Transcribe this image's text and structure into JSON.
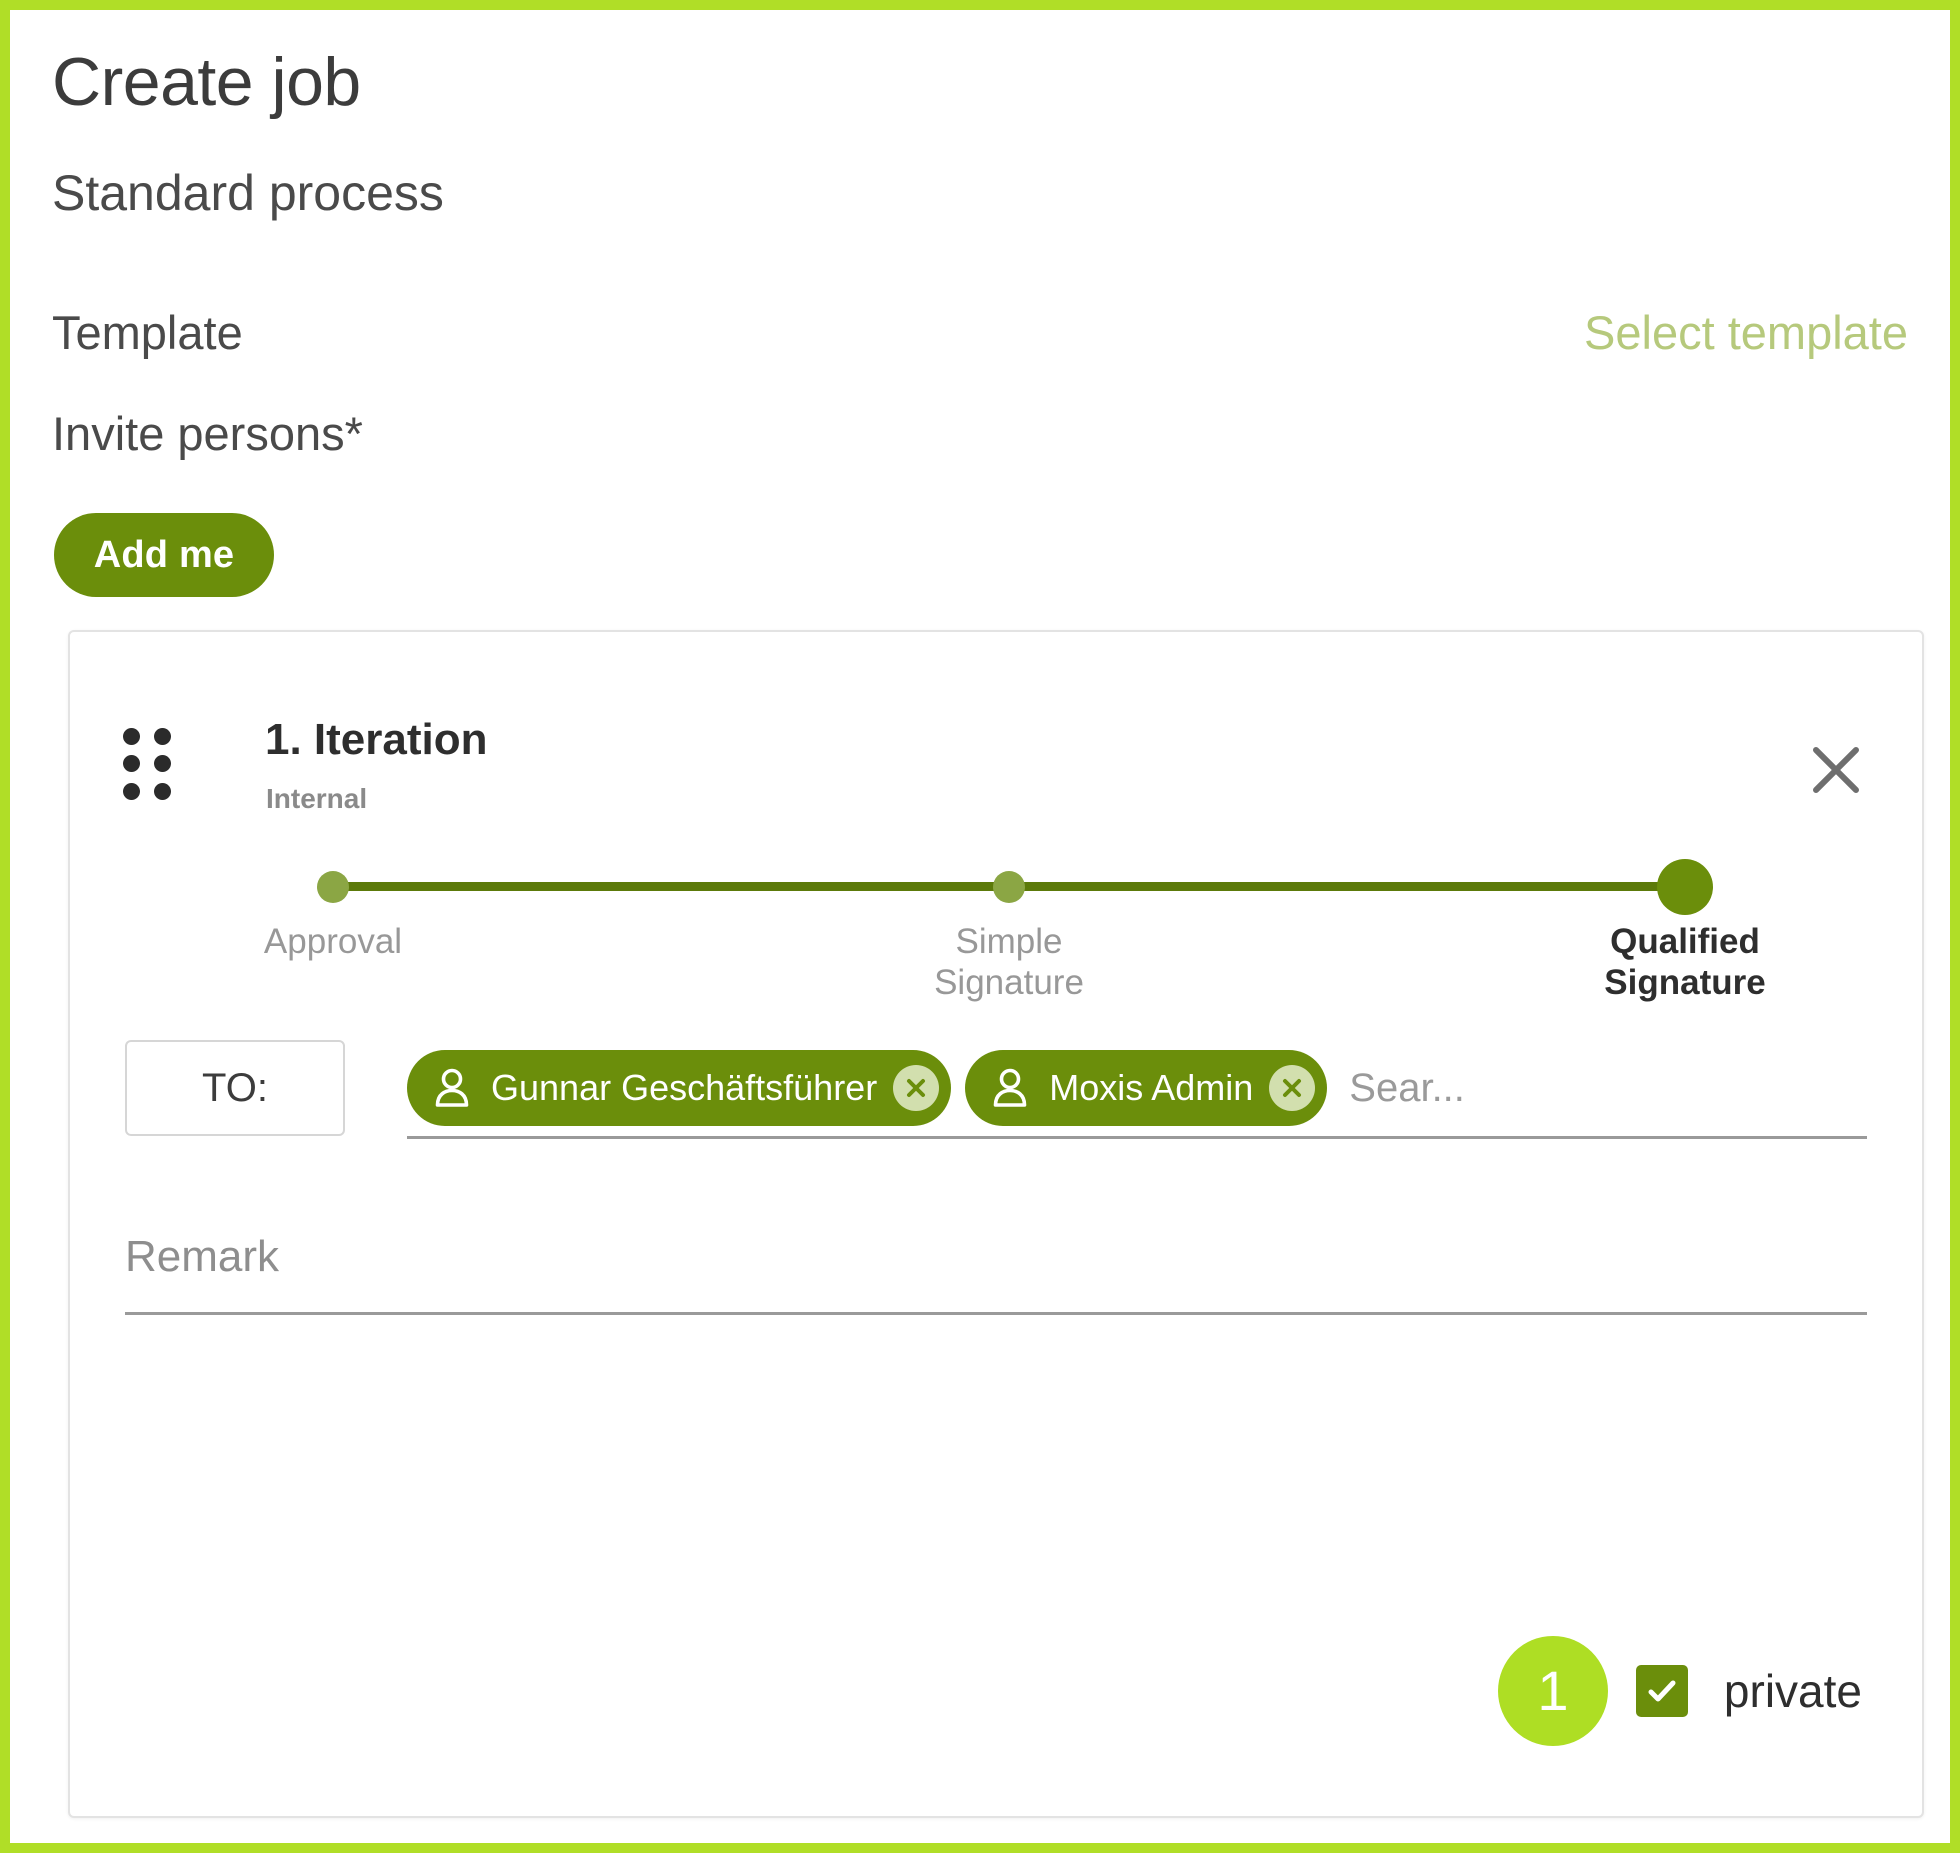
{
  "page": {
    "title": "Create job",
    "subtitle": "Standard process"
  },
  "template": {
    "label": "Template",
    "select_label": "Select template"
  },
  "invite": {
    "label": "Invite persons*",
    "add_me_label": "Add me"
  },
  "iteration": {
    "title": "1. Iteration",
    "subtitle": "Internal",
    "close_icon": "close-icon",
    "drag_icon": "drag-handle-icon",
    "steps": [
      {
        "label": "Approval",
        "active": false
      },
      {
        "label": "Simple\nSignature",
        "active": false
      },
      {
        "label": "Qualified\nSignature",
        "active": true
      }
    ],
    "recipients": {
      "to_label": "TO:",
      "chips": [
        {
          "name": "Gunnar Geschäftsführer",
          "icon": "person-icon",
          "remove_icon": "remove-circle-icon"
        },
        {
          "name": "Moxis Admin",
          "icon": "person-icon",
          "remove_icon": "remove-circle-icon"
        }
      ],
      "search_placeholder": "Sear...",
      "search_value": ""
    },
    "remark": {
      "placeholder": "Remark",
      "value": ""
    },
    "footer": {
      "badge_number": "1",
      "private_label": "private",
      "private_checked": true,
      "check_icon": "check-icon"
    }
  },
  "colors": {
    "frame_green": "#b0de27",
    "primary_green": "#6b8e0b",
    "badge_green": "#aede24",
    "muted_green": "#b6c97c",
    "step_inactive": "#8ba644",
    "chip_remove_bg": "#d2dfae"
  }
}
